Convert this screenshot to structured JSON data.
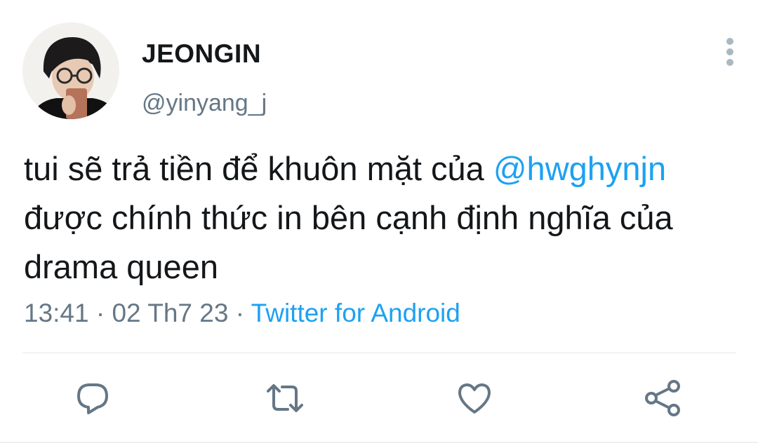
{
  "user": {
    "display_name": "JEONGIN",
    "handle": "@yinyang_j"
  },
  "tweet": {
    "text_before": "tui sẽ trả tiền để khuôn mặt của ",
    "mention": "@hwghynjn",
    "text_after": " được chính thức in bên cạnh định nghĩa của drama queen",
    "time": "13:41",
    "separator": " · ",
    "date": "02 Th7 23",
    "source": "Twitter for Android"
  },
  "icons": {
    "more": "more-vertical-icon",
    "reply": "reply-icon",
    "retweet": "retweet-icon",
    "like": "heart-icon",
    "share": "share-icon"
  },
  "colors": {
    "accent": "#1da1f2",
    "text": "#14171a",
    "muted": "#657786",
    "divider": "#e1e8ed"
  }
}
